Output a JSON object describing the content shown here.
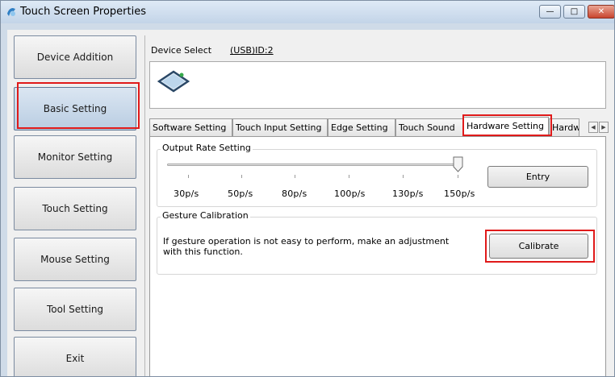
{
  "window": {
    "title": "Touch Screen Properties",
    "controls": {
      "minimize": "—",
      "maximize": "□",
      "close": "✕"
    }
  },
  "sidebar": {
    "items": [
      {
        "label": "Device Addition"
      },
      {
        "label": "Basic Setting",
        "active": true
      },
      {
        "label": "Monitor Setting"
      },
      {
        "label": "Touch Setting"
      },
      {
        "label": "Mouse Setting"
      },
      {
        "label": "Tool Setting"
      },
      {
        "label": "Exit"
      }
    ]
  },
  "device": {
    "label": "Device Select",
    "value": "(USB)ID:2",
    "icon": "touch-panel-icon"
  },
  "tabs": [
    {
      "label": "Software Setting"
    },
    {
      "label": "Touch Input Setting"
    },
    {
      "label": "Edge Setting"
    },
    {
      "label": "Touch Sound"
    },
    {
      "label": "Hardware Setting",
      "selected": true
    },
    {
      "label": "Hardwa"
    }
  ],
  "tab_scroll": {
    "left": "◀",
    "right": "▶"
  },
  "output_rate": {
    "title": "Output Rate Setting",
    "ticks": [
      "30p/s",
      "50p/s",
      "80p/s",
      "100p/s",
      "130p/s",
      "150p/s"
    ],
    "selected": "150p/s",
    "entry_label": "Entry"
  },
  "gesture": {
    "title": "Gesture Calibration",
    "message": "If gesture operation is not easy to perform, make an adjustment with this function.",
    "calibrate_label": "Calibrate"
  },
  "colors": {
    "highlight": "#e01a1a",
    "titlebar": "#c3d4e8",
    "active_nav": "#b9cde2"
  }
}
